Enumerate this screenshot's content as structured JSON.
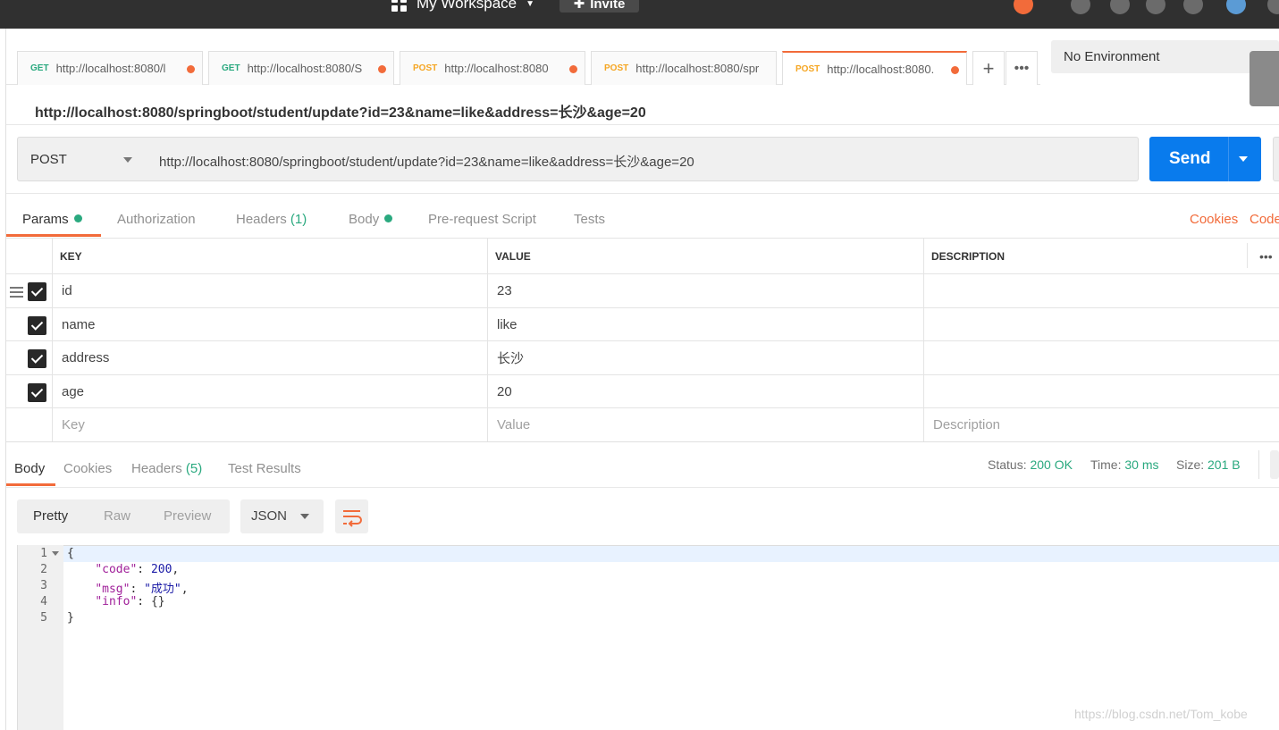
{
  "topbar": {
    "workspace": "My Workspace",
    "invite": "Invite"
  },
  "tabs": [
    {
      "method": "GET",
      "url": "http://localhost:8080/l"
    },
    {
      "method": "GET",
      "url": "http://localhost:8080/S"
    },
    {
      "method": "POST",
      "url": "http://localhost:8080"
    },
    {
      "method": "POST",
      "url": "http://localhost:8080/spr"
    },
    {
      "method": "POST",
      "url": "http://localhost:8080."
    }
  ],
  "environment": "No Environment",
  "request": {
    "title": "http://localhost:8080/springboot/student/update?id=23&name=like&address=长沙&age=20",
    "method": "POST",
    "url": "http://localhost:8080/springboot/student/update?id=23&name=like&address=长沙&age=20",
    "send": "Send"
  },
  "request_tabs": {
    "params": "Params",
    "authorization": "Authorization",
    "headers": "Headers",
    "headers_count": "(1)",
    "body": "Body",
    "prerequest": "Pre-request Script",
    "tests": "Tests",
    "cookies": "Cookies",
    "code": "Code"
  },
  "params": {
    "columns": [
      "KEY",
      "VALUE",
      "DESCRIPTION"
    ],
    "rows": [
      {
        "key": "id",
        "value": "23",
        "description": ""
      },
      {
        "key": "name",
        "value": "like",
        "description": ""
      },
      {
        "key": "address",
        "value": "长沙",
        "description": ""
      },
      {
        "key": "age",
        "value": "20",
        "description": ""
      }
    ],
    "placeholder": {
      "key": "Key",
      "value": "Value",
      "description": "Description"
    }
  },
  "response": {
    "tabs": {
      "body": "Body",
      "cookies": "Cookies",
      "headers": "Headers",
      "headers_count": "(5)",
      "test_results": "Test Results"
    },
    "status_label": "Status:",
    "status": "200 OK",
    "time_label": "Time:",
    "time": "30 ms",
    "size_label": "Size:",
    "size": "201 B",
    "format_buttons": [
      "Pretty",
      "Raw",
      "Preview"
    ],
    "format": "JSON",
    "code_lines": [
      "1",
      "2",
      "3",
      "4",
      "5"
    ],
    "json": {
      "code_key": "\"code\"",
      "code_val": "200",
      "msg_key": "\"msg\"",
      "msg_val": "\"成功\"",
      "info_key": "\"info\"",
      "info_val": "{}"
    }
  },
  "watermark": "https://blog.csdn.net/Tom_kobe",
  "colors": {
    "accent": "#f26b3a",
    "send": "#097bed",
    "success": "#2aa97f"
  }
}
